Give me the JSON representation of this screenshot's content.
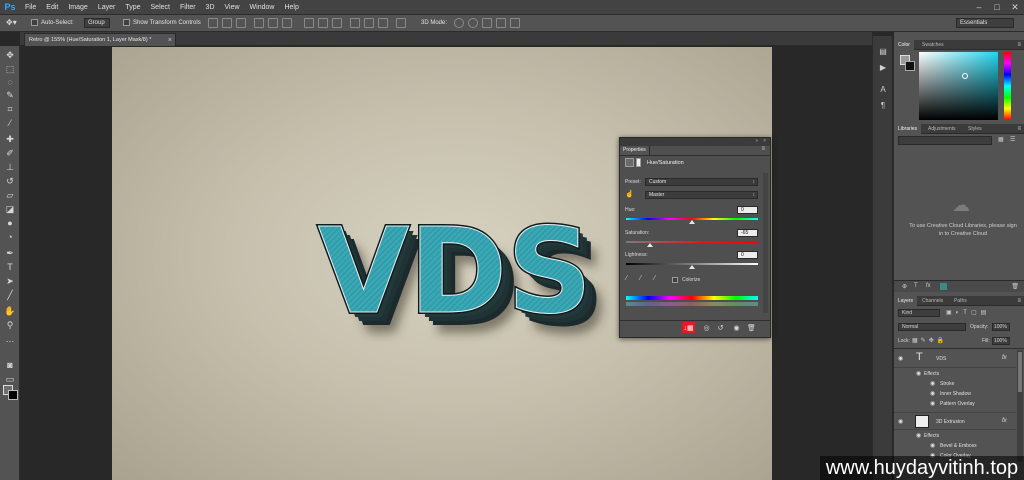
{
  "app": {
    "logo": "Ps",
    "menus": [
      "File",
      "Edit",
      "Image",
      "Layer",
      "Type",
      "Select",
      "Filter",
      "3D",
      "View",
      "Window",
      "Help"
    ],
    "window_controls": [
      "–",
      "□",
      "✕"
    ]
  },
  "options": {
    "auto_select_label": "Auto-Select:",
    "auto_select_value": "Group",
    "transform_label": "Show Transform Controls",
    "mode_3d_label": "3D Mode:",
    "workspace_value": "Essentials"
  },
  "document": {
    "tab_title": "Retro @ 155% (Hue/Saturation 1, Layer Mask/8) *",
    "tab_close": "×",
    "artwork_text": "VDS"
  },
  "tools": [
    "move-icon",
    "marquee-icon",
    "lasso-icon",
    "quick-select-icon",
    "crop-icon",
    "eyedropper-icon",
    "healing-icon",
    "brush-icon",
    "clone-stamp-icon",
    "history-brush-icon",
    "eraser-icon",
    "paint-bucket-icon",
    "blur-icon",
    "dodge-icon",
    "pen-icon",
    "type-icon",
    "path-select-icon",
    "line-icon",
    "hand-icon",
    "zoom-icon",
    "more-icon"
  ],
  "properties": {
    "tab": "Properties",
    "title": "Hue/Saturation",
    "preset_label": "Preset:",
    "preset_value": "Custom",
    "channel_value": "Master",
    "hue_label": "Hue:",
    "hue_value": "0",
    "saturation_label": "Saturation:",
    "saturation_value": "-65",
    "lightness_label": "Lightness:",
    "lightness_value": "0",
    "colorize_label": "Colorize",
    "highlight_color": "#e21a22"
  },
  "color_panel": {
    "tabs": [
      "Color",
      "Swatches"
    ]
  },
  "libraries": {
    "tabs": [
      "Libraries",
      "Adjustments",
      "Styles"
    ],
    "message": "To use Creative Cloud Libraries, please sign in to Creative Cloud"
  },
  "layers": {
    "tabs": [
      "Layers",
      "Channels",
      "Paths"
    ],
    "filter_value": "Kind",
    "blend_mode": "Normal",
    "opacity_label": "Opacity:",
    "opacity_value": "100%",
    "lock_label": "Lock:",
    "fill_label": "Fill:",
    "fill_value": "100%",
    "items": [
      {
        "name": "VDS",
        "fx": "fx",
        "effects_label": "Effects",
        "effects": [
          "Stroke",
          "Inner Shadow",
          "Pattern Overlay"
        ]
      },
      {
        "name": "3D Extrusion",
        "fx": "fx",
        "effects_label": "Effects",
        "effects": [
          "Bevel & Emboss",
          "Color Overlay"
        ]
      }
    ]
  },
  "watermark": "www.huydayvitinh.top"
}
